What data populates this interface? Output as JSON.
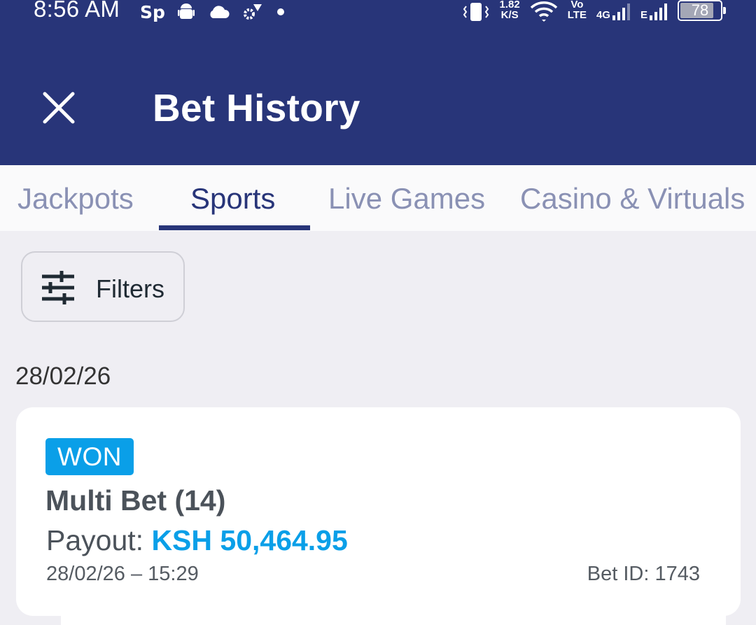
{
  "status_bar": {
    "time": "8:56 AM",
    "carrier_badge": "Sp",
    "net_speed_value": "1.82",
    "net_speed_unit": "K/S",
    "volte_top": "Vo",
    "volte_bottom": "LTE",
    "network_4g": "4G",
    "network_e": "E",
    "battery": "78",
    "icons": [
      "android-icon",
      "cloud-icon",
      "settings-icon",
      "dot-icon",
      "vibrate-icon",
      "wifi-icon",
      "signal-icon",
      "signal-icon",
      "battery-icon"
    ]
  },
  "header": {
    "title": "Bet History",
    "close_icon": "close-icon",
    "bg_color": "#283579"
  },
  "tabs": [
    {
      "label": "Jackpots",
      "active": false
    },
    {
      "label": "Sports",
      "active": true
    },
    {
      "label": "Live Games",
      "active": false
    },
    {
      "label": "Casino & Virtuals",
      "active": false
    }
  ],
  "filters": {
    "label": "Filters",
    "icon": "sliders-icon"
  },
  "bets": {
    "date_heading": "28/02/26",
    "items": [
      {
        "status": "WON",
        "bet_type": "Multi Bet (14)",
        "payout_label": "Payout: ",
        "payout_value": "KSH 50,464.95",
        "datetime": "28/02/26 – 15:29",
        "bet_id": "Bet ID: 1743"
      }
    ]
  },
  "colors": {
    "accent": "#0a9fe8",
    "primary": "#283579",
    "tab_inactive": "#8a91b4",
    "background": "#efeef3"
  }
}
